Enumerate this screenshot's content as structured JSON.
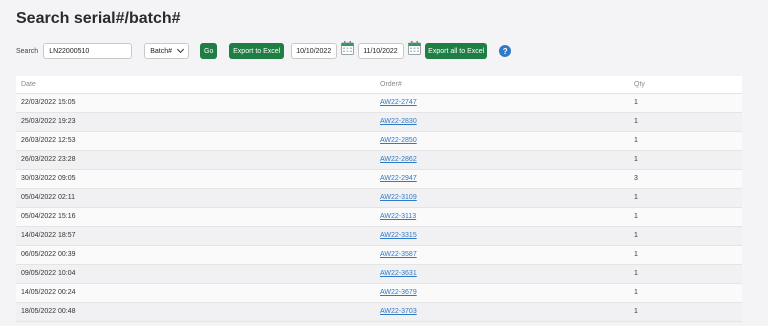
{
  "page": {
    "title": "Search serial#/batch#"
  },
  "search": {
    "label": "Search",
    "value": "LN22000510",
    "type_select": "Batch#",
    "go_label": "Go",
    "export_label": "Export to Excel",
    "date_from": "10/10/2022",
    "date_to": "11/10/2022",
    "export_all_label": "Export all to Excel",
    "help_symbol": "?"
  },
  "colors": {
    "button_green": "#1e7e43",
    "link_blue": "#2f79c9",
    "help_blue": "#2f79c9"
  },
  "icons": [
    "chevron-down-icon",
    "calendar-icon",
    "help-icon"
  ],
  "table": {
    "headers": {
      "date": "Date",
      "order": "Order#",
      "qty": "Qty"
    },
    "rows": [
      {
        "date": "22/03/2022 15:05",
        "order": "AW22-2747",
        "qty": "1"
      },
      {
        "date": "25/03/2022 19:23",
        "order": "AW22-2830",
        "qty": "1"
      },
      {
        "date": "26/03/2022 12:53",
        "order": "AW22-2850",
        "qty": "1"
      },
      {
        "date": "26/03/2022 23:28",
        "order": "AW22-2862",
        "qty": "1"
      },
      {
        "date": "30/03/2022 09:05",
        "order": "AW22-2947",
        "qty": "3"
      },
      {
        "date": "05/04/2022 02:11",
        "order": "AW22-3109",
        "qty": "1"
      },
      {
        "date": "05/04/2022 15:16",
        "order": "AW22-3113",
        "qty": "1"
      },
      {
        "date": "14/04/2022 18:57",
        "order": "AW22-3315",
        "qty": "1"
      },
      {
        "date": "06/05/2022 00:39",
        "order": "AW22-3587",
        "qty": "1"
      },
      {
        "date": "09/05/2022 10:04",
        "order": "AW22-3631",
        "qty": "1"
      },
      {
        "date": "14/05/2022 00:24",
        "order": "AW22-3679",
        "qty": "1"
      },
      {
        "date": "18/05/2022 00:48",
        "order": "AW22-3703",
        "qty": "1"
      }
    ]
  }
}
